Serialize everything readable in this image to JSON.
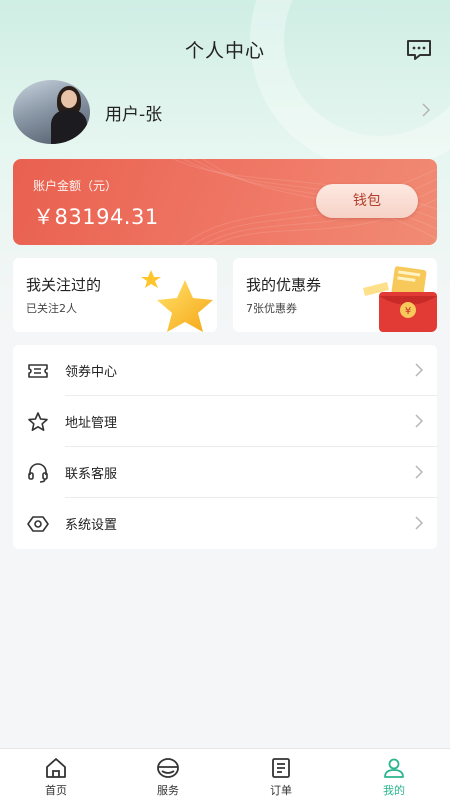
{
  "header": {
    "title": "个人中心",
    "message_icon": "message-dots-icon"
  },
  "profile": {
    "username": "用户-张",
    "avatar_icon": "avatar"
  },
  "balance": {
    "label": "账户金额（元）",
    "value": "￥83194.31",
    "wallet_button": "钱包"
  },
  "tiles": {
    "follow": {
      "title": "我关注过的",
      "subtitle": "已关注2人",
      "icon": "star-icon"
    },
    "coupon": {
      "title": "我的优惠券",
      "subtitle": "7张优惠券",
      "icon": "coupon-wallet-icon"
    }
  },
  "menu": {
    "items": [
      {
        "label": "领券中心",
        "icon": "ticket-icon"
      },
      {
        "label": "地址管理",
        "icon": "star-outline-icon"
      },
      {
        "label": "联系客服",
        "icon": "headset-icon"
      },
      {
        "label": "系统设置",
        "icon": "settings-icon"
      }
    ]
  },
  "tabbar": {
    "tabs": [
      {
        "label": "首页",
        "icon": "home-icon"
      },
      {
        "label": "服务",
        "icon": "service-icon"
      },
      {
        "label": "订单",
        "icon": "order-icon"
      },
      {
        "label": "我的",
        "icon": "user-icon",
        "active": true
      }
    ]
  },
  "colors": {
    "accent": "#2bb58e",
    "card_red": "#ec6a58",
    "header_mint": "#cfeee4"
  }
}
